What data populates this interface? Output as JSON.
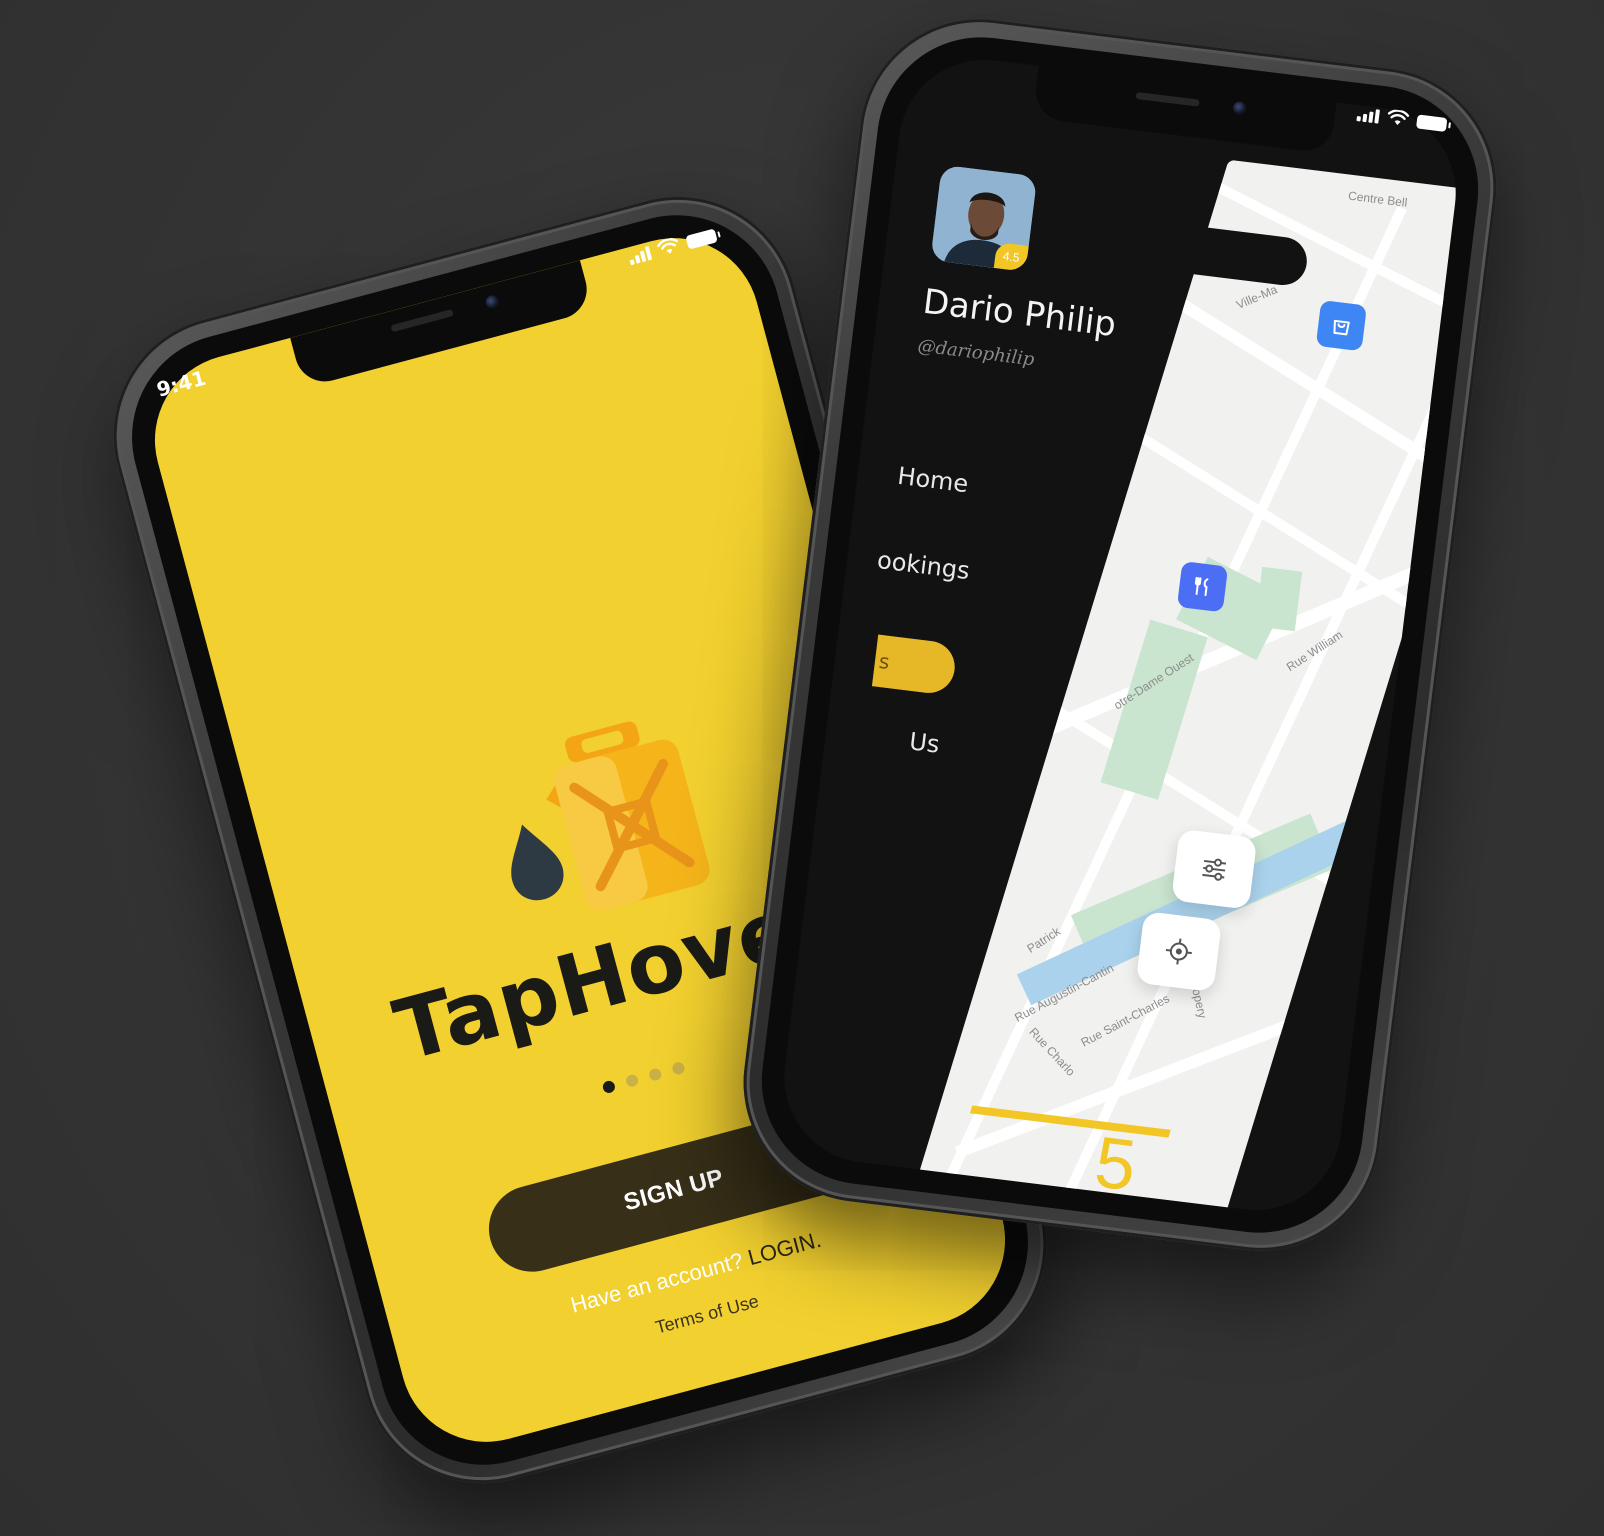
{
  "phone_left": {
    "status_time": "9:41",
    "brand_title": "TapHover",
    "pager": {
      "total": 4,
      "active_index": 0
    },
    "signup_label": "SIGN UP",
    "have_account_text": "Have an account?",
    "login_label": "LOGIN.",
    "terms_label": "Terms of Use",
    "colors": {
      "background": "#f2d02f",
      "button": "#372f17",
      "text_dark": "#1a1a16"
    }
  },
  "phone_right": {
    "user": {
      "name": "Dario Philip",
      "handle": "@dariophilip",
      "rating": "4.5"
    },
    "menu": [
      {
        "label": "Home"
      },
      {
        "label": "ookings"
      },
      {
        "label": "s"
      },
      {
        "label": "Us"
      }
    ],
    "map": {
      "labels": {
        "centre_bell": "Centre Bell",
        "ville_ma": "Ville-Ma",
        "notre_dame": "otre-Dame Ouest",
        "rue_william": "Rue William",
        "patrick": "Patrick",
        "augustin": "Rue Augustin-Cantin",
        "saint_charles": "Rue Saint-Charles",
        "charlo": "Rue Charlo",
        "ropery": "Ropery"
      },
      "pins": [
        "shopping-bag-icon",
        "restaurant-icon"
      ],
      "controls": [
        "filter-sliders-icon",
        "locate-target-icon"
      ]
    },
    "page_number": "5",
    "colors": {
      "background": "#121212",
      "accent": "#f2c624",
      "pin_blue": "#3f86f5"
    }
  }
}
